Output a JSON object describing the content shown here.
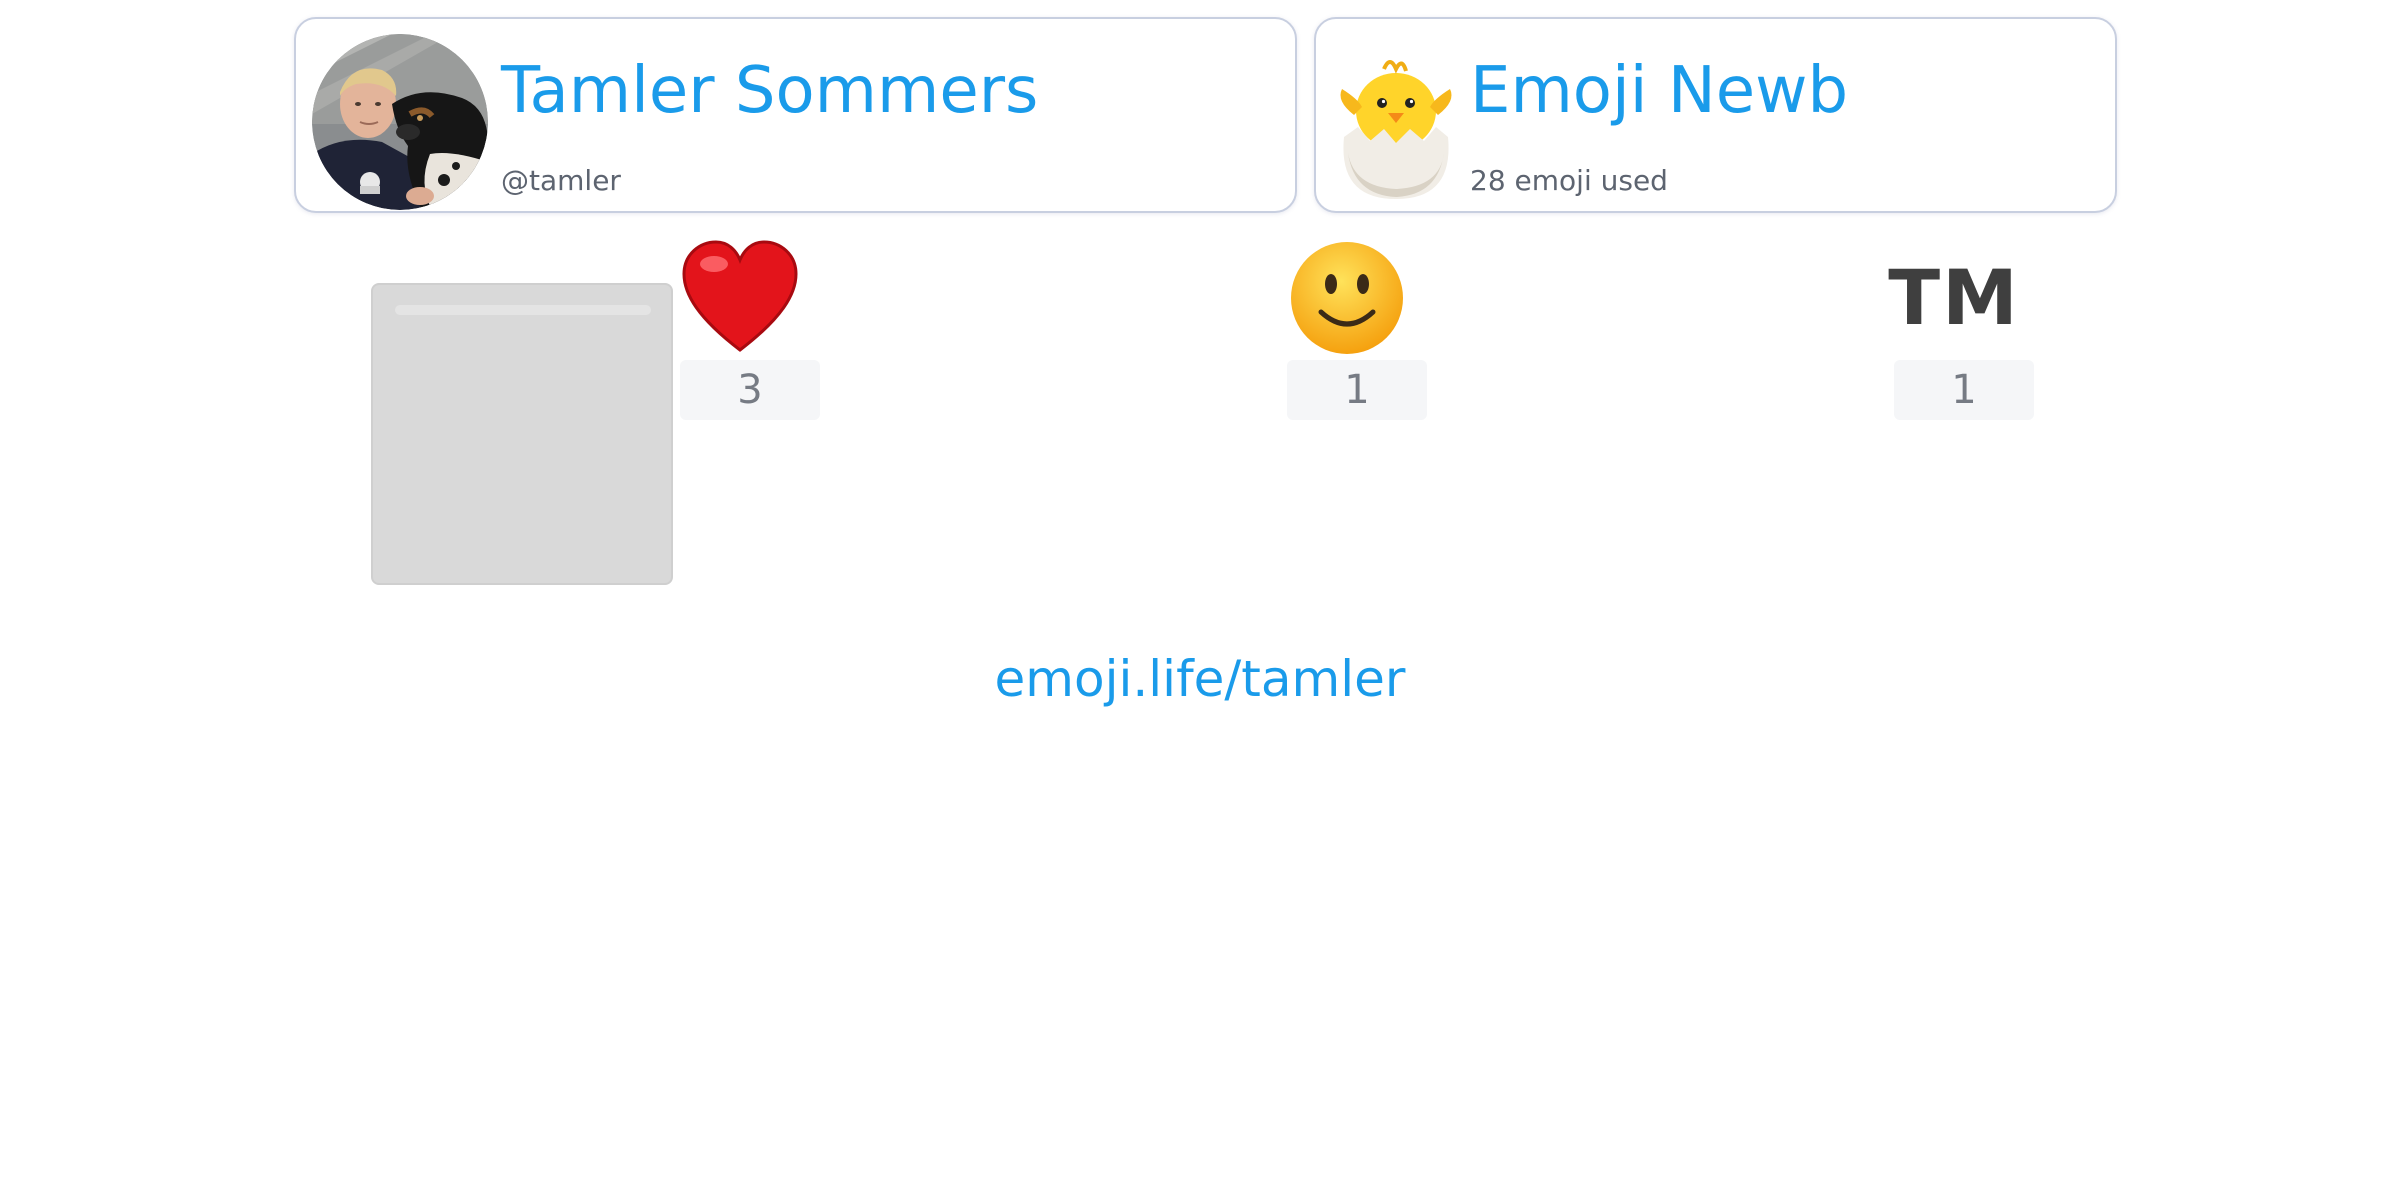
{
  "user_card": {
    "name": "Tamler Sommers",
    "handle": "@tamler",
    "avatar_icon": "user-photo-with-dog"
  },
  "rank_card": {
    "title": "Emoji Newb",
    "subtitle": "28 emoji used",
    "badge_icon": "hatching-chick-icon"
  },
  "emoji_items": [
    {
      "icon": "red-heart-icon",
      "count": "3"
    },
    {
      "icon": "slightly-smiling-face-icon",
      "count": "1"
    },
    {
      "icon": "trademark-icon",
      "glyph": "TM",
      "count": "1"
    }
  ],
  "footer": {
    "link": "emoji.life/tamler"
  },
  "colors": {
    "accent": "#1a9bea",
    "subtext": "#5d6470",
    "count_text": "#767b84",
    "count_bg": "#f5f6f8",
    "card_border": "#c8cfe0",
    "placeholder": "#d9d9d9"
  }
}
